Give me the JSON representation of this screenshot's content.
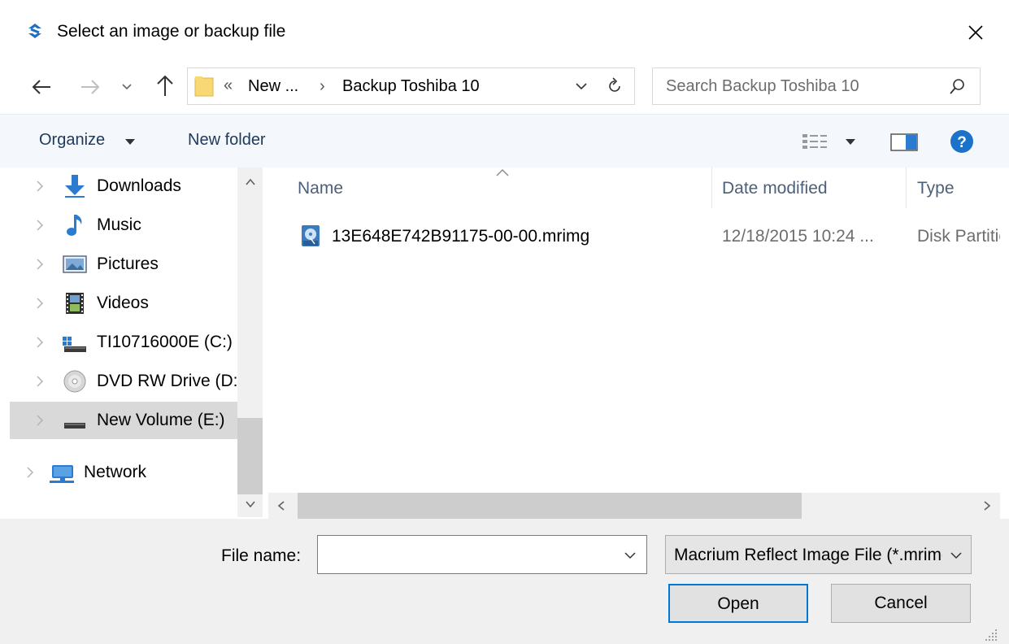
{
  "window": {
    "title": "Select an image or backup file",
    "accent": "#0078d7"
  },
  "navigation": {
    "breadcrumb_parent": "New ...",
    "breadcrumb_current": "Backup Toshiba 10",
    "search_placeholder": "Search Backup Toshiba 10"
  },
  "toolbar": {
    "organize_label": "Organize",
    "new_folder_label": "New folder",
    "help_color": "#1a73c8"
  },
  "sidebar": {
    "items": [
      {
        "label": "Downloads",
        "icon": "downloads-icon"
      },
      {
        "label": "Music",
        "icon": "music-icon"
      },
      {
        "label": "Pictures",
        "icon": "pictures-icon"
      },
      {
        "label": "Videos",
        "icon": "videos-icon"
      },
      {
        "label": "TI10716000E (C:)",
        "icon": "system-drive-icon"
      },
      {
        "label": "DVD RW Drive (D:)",
        "icon": "dvd-drive-icon"
      },
      {
        "label": "New Volume (E:)",
        "icon": "drive-icon",
        "selected": true
      },
      {
        "label": "Network",
        "icon": "network-icon"
      }
    ]
  },
  "files": {
    "columns": [
      "Name",
      "Date modified",
      "Type"
    ],
    "rows": [
      {
        "name": "13E648E742B91175-00-00.mrimg",
        "date_modified": "12/18/2015 10:24 ...",
        "type": "Disk Partition Image"
      }
    ]
  },
  "footer": {
    "file_name_label": "File name:",
    "file_name_value": "",
    "filter_value": "Macrium Reflect Image File (*.mrimg)",
    "open_label": "Open",
    "cancel_label": "Cancel"
  }
}
